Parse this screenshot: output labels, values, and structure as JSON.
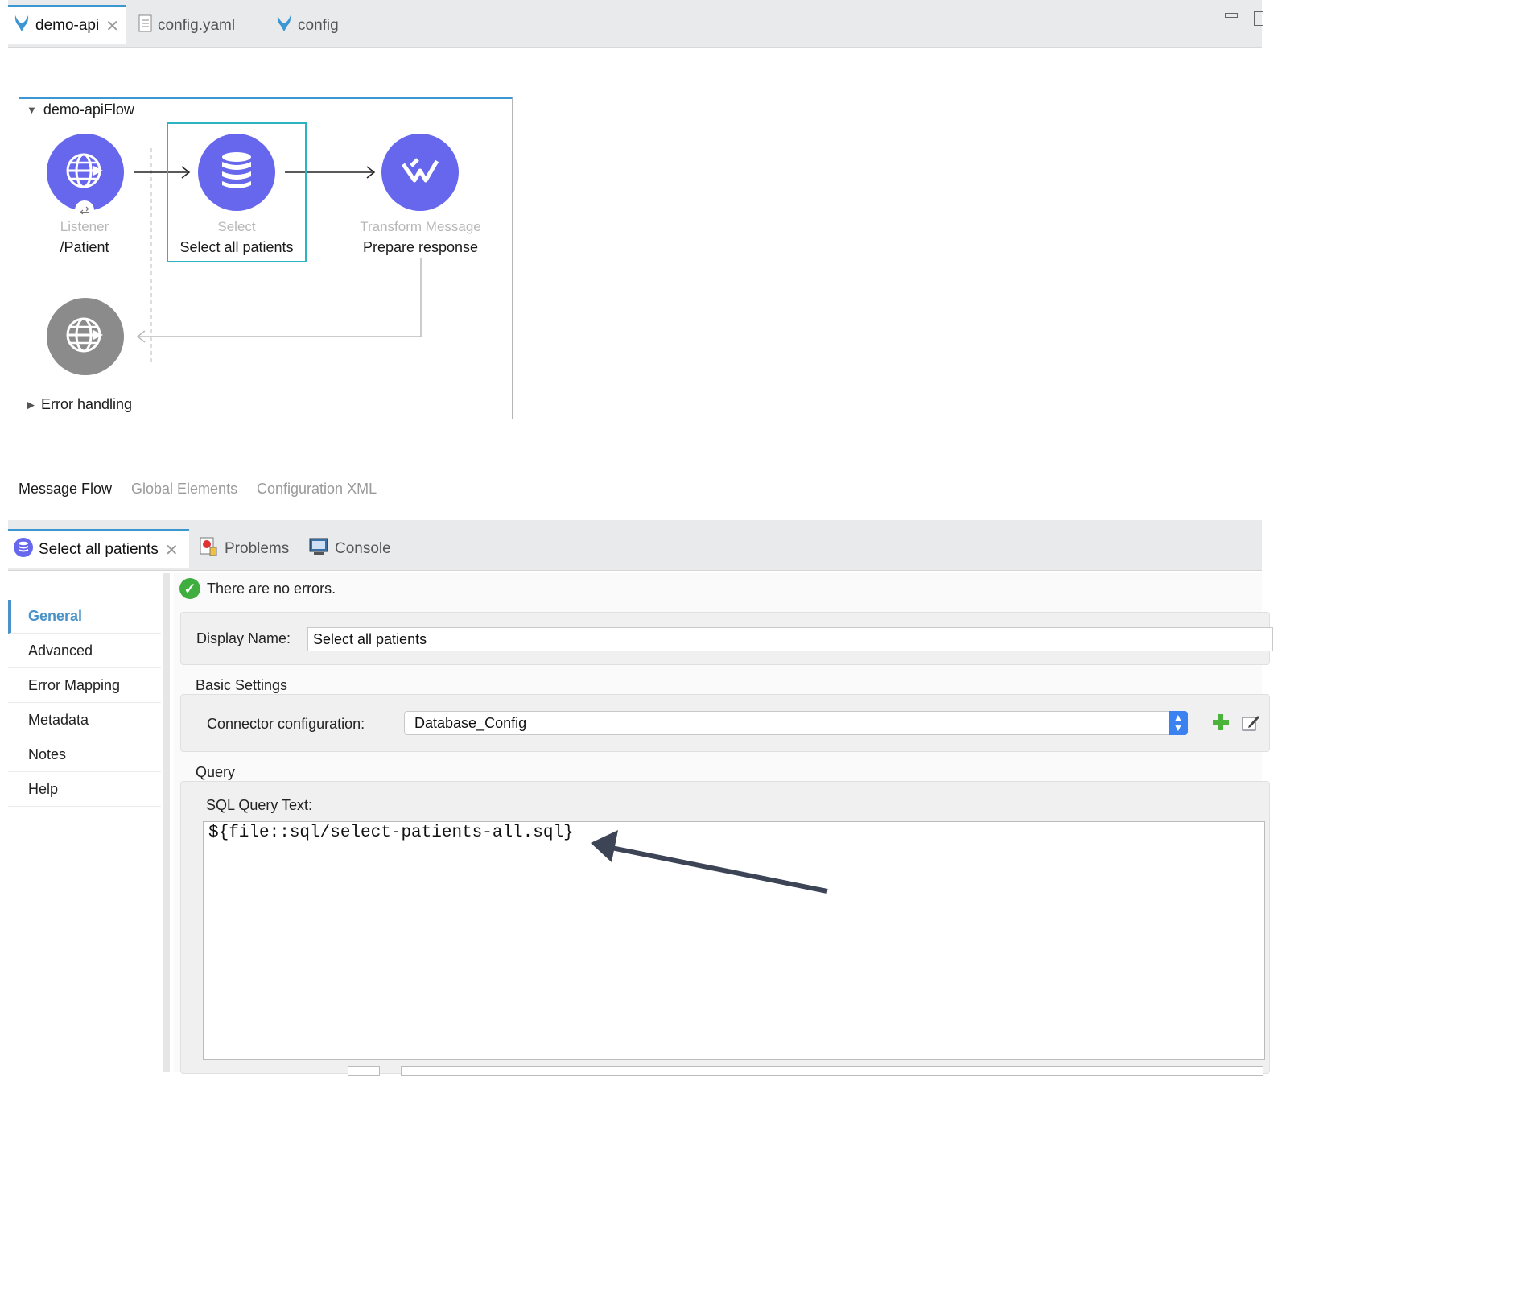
{
  "editor_tabs": [
    {
      "label": "demo-api",
      "icon": "mule-icon",
      "active": true
    },
    {
      "label": "config.yaml",
      "icon": "file-icon",
      "active": false
    },
    {
      "label": "config",
      "icon": "mule-icon",
      "active": false
    }
  ],
  "flow": {
    "name": "demo-apiFlow",
    "nodes": [
      {
        "type": "Listener",
        "name": "/Patient",
        "icon": "globe-icon"
      },
      {
        "type": "Select",
        "name": "Select all patients",
        "icon": "database-icon"
      },
      {
        "type": "Transform Message",
        "name": "Prepare response",
        "icon": "dataweave-icon"
      }
    ],
    "error_handling": "Error handling"
  },
  "canvas_tabs": [
    "Message Flow",
    "Global Elements",
    "Configuration XML"
  ],
  "panel_tabs": [
    {
      "label": "Select all patients",
      "icon": "database-icon"
    },
    {
      "label": "Problems",
      "icon": "problems-icon"
    },
    {
      "label": "Console",
      "icon": "console-icon"
    }
  ],
  "nav": [
    "General",
    "Advanced",
    "Error Mapping",
    "Metadata",
    "Notes",
    "Help"
  ],
  "status": "There are no errors.",
  "form": {
    "display_name_label": "Display Name:",
    "display_name_value": "Select all patients",
    "basic_settings": "Basic Settings",
    "connector_label": "Connector configuration:",
    "connector_value": "Database_Config",
    "query_section": "Query",
    "sql_label": "SQL Query Text:",
    "sql_value": "${file::sql/select-patients-all.sql}"
  },
  "colors": {
    "accent": "#3c96d2",
    "node": "#6767ee",
    "selection": "#2bb5c4"
  }
}
